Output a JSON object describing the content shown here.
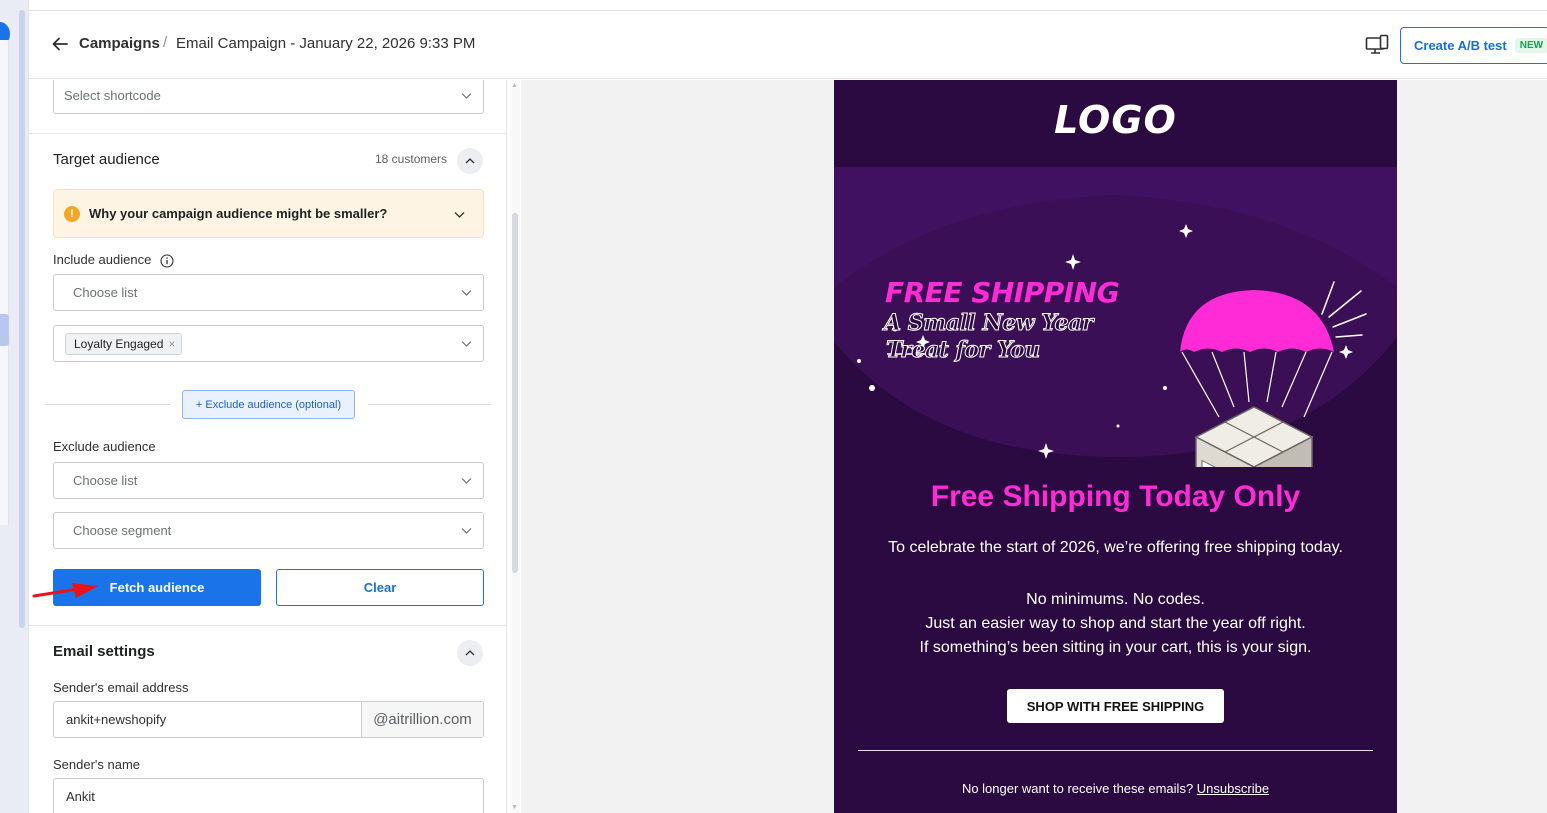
{
  "header": {
    "breadcrumb_root": "Campaigns",
    "breadcrumb_sep": "/",
    "breadcrumb_current": "Email Campaign - January 22, 2026 9:33 PM",
    "ab_test_label": "Create A/B test",
    "ab_test_badge": "NEW"
  },
  "panel": {
    "shortcode_placeholder": "Select shortcode",
    "target": {
      "title": "Target audience",
      "count": "18 customers",
      "warning": "Why your campaign audience might be smaller?",
      "include_label": "Include audience",
      "include_list_placeholder": "Choose list",
      "include_selected_tag": "Loyalty Engaged",
      "tag_remove": "×",
      "exclude_button": "+ Exclude audience (optional)",
      "exclude_label": "Exclude audience",
      "exclude_list_placeholder": "Choose list",
      "exclude_segment_placeholder": "Choose segment",
      "fetch_button": "Fetch audience",
      "clear_button": "Clear"
    },
    "email_settings": {
      "title": "Email settings",
      "sender_email_label": "Sender's email address",
      "sender_email_user": "ankit+newshopify",
      "sender_email_domain": "@aitrillion.com",
      "sender_name_label": "Sender's name",
      "sender_name_value": "Ankit"
    }
  },
  "email_preview": {
    "logo": "LOGO",
    "hero_line1": "FREE SHIPPING",
    "hero_line2": "A Small New Year",
    "hero_line3": "Treat for You",
    "heading": "Free Shipping Today Only",
    "para1": "To celebrate the start of 2026, we’re offering free shipping today.",
    "para2": "No minimums. No codes.",
    "para3": "Just an easier way to shop and start the year off right.",
    "para4": "If something’s been sitting in your cart, this is your sign.",
    "cta": "SHOP WITH FREE SHIPPING",
    "unsubscribe_text": "No longer want to receive these emails?",
    "unsubscribe_link": "Unsubscribe"
  },
  "colors": {
    "primary": "#1a73e8",
    "email_bg": "#2a0a40",
    "email_accent": "#ff2bd6",
    "warning_bg": "#fdf4e3"
  }
}
